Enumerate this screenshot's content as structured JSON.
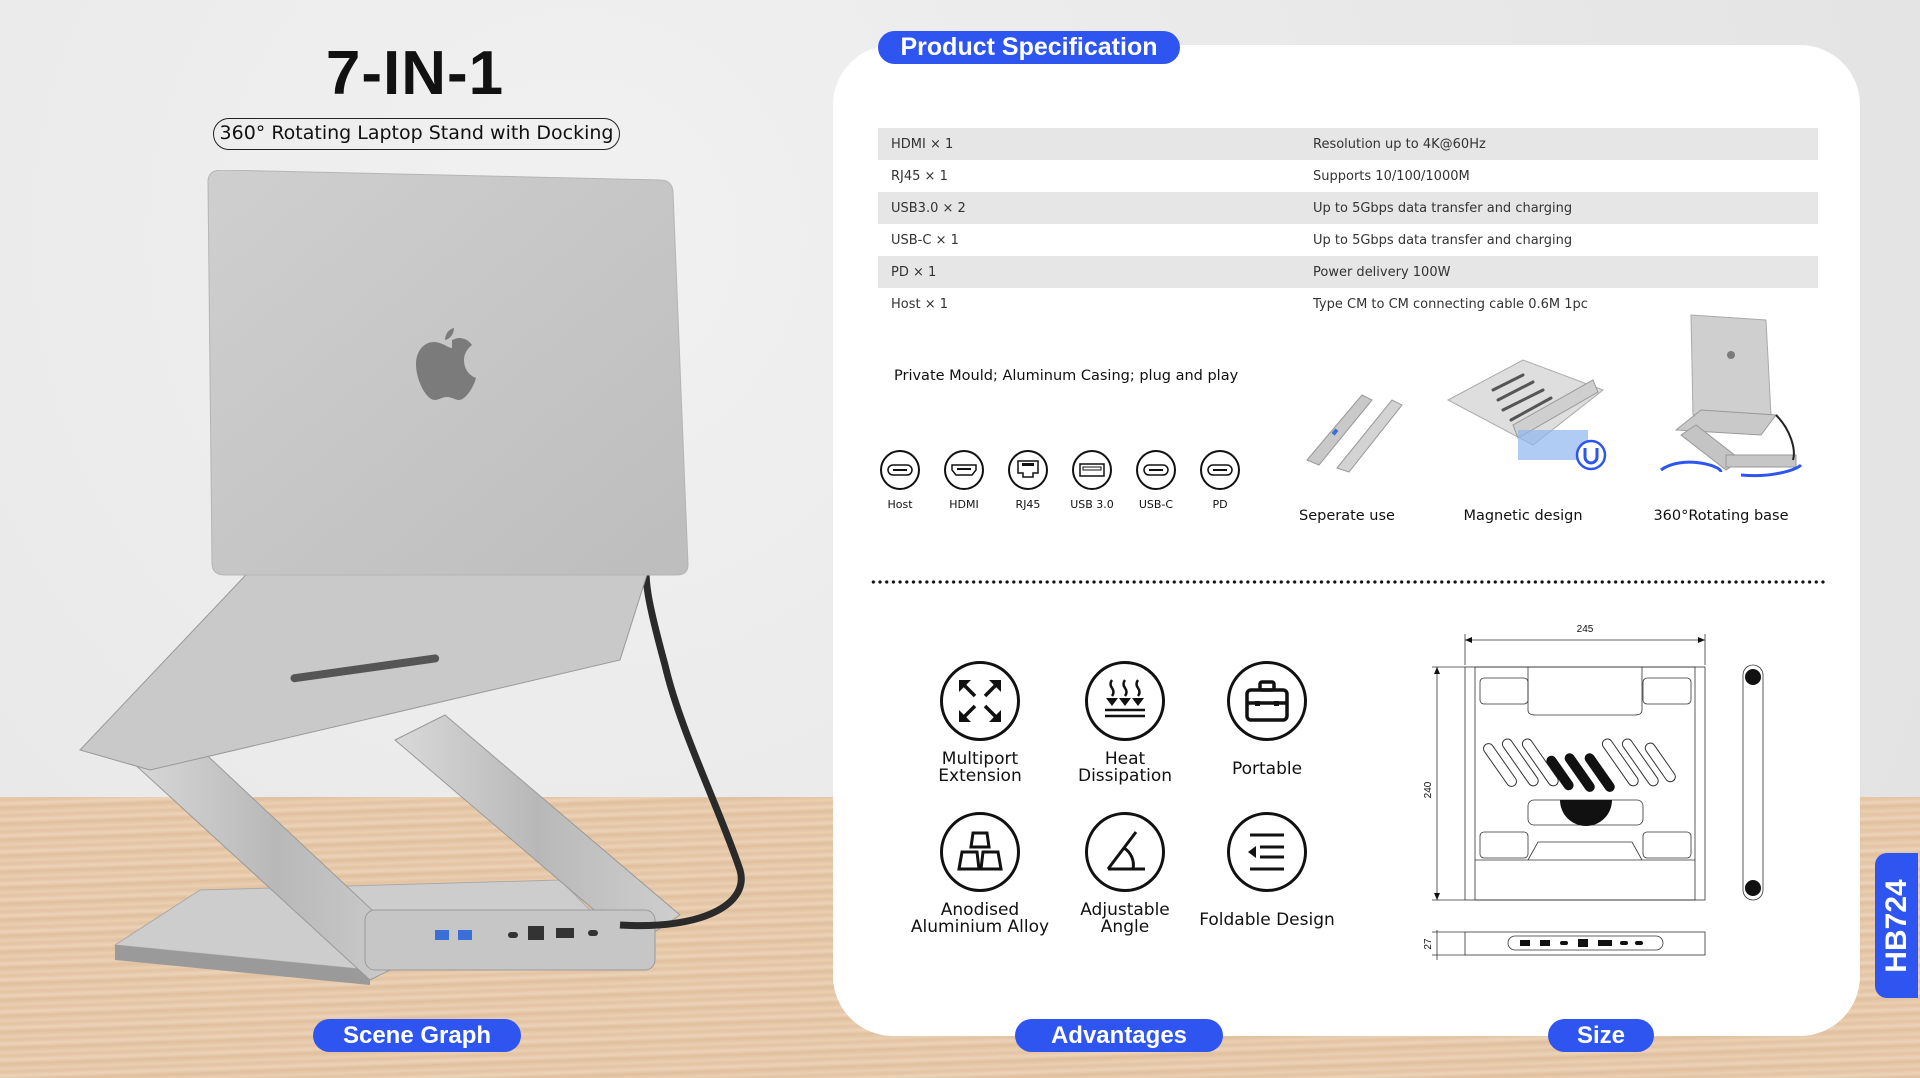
{
  "header": {
    "title": "7-IN-1",
    "subtitle": "360° Rotating Laptop Stand with Docking"
  },
  "spec": {
    "heading": "Product Specification",
    "rows": [
      {
        "port": "HDMI × 1",
        "desc": "Resolution up to 4K@60Hz"
      },
      {
        "port": "RJ45 × 1",
        "desc": "Supports 10/100/1000M"
      },
      {
        "port": "USB3.0 × 2",
        "desc": "Up to 5Gbps data transfer and charging"
      },
      {
        "port": "USB-C × 1",
        "desc": "Up to 5Gbps data transfer and charging"
      },
      {
        "port": "PD × 1",
        "desc": "Power delivery 100W"
      },
      {
        "port": "Host × 1",
        "desc": "Type CM to CM connecting cable 0.6M 1pc"
      }
    ],
    "tagline": "Private Mould; Aluminum Casing; plug and play",
    "port_icons": [
      {
        "label": "Host",
        "icon": "usb-c-port-icon"
      },
      {
        "label": "HDMI",
        "icon": "hdmi-port-icon"
      },
      {
        "label": "RJ45",
        "icon": "rj45-port-icon"
      },
      {
        "label": "USB 3.0",
        "icon": "usb-a-port-icon"
      },
      {
        "label": "USB-C",
        "icon": "usb-c-port-icon"
      },
      {
        "label": "PD",
        "icon": "usb-c-port-icon"
      }
    ],
    "features": [
      {
        "label": "Seperate use"
      },
      {
        "label": "Magnetic design"
      },
      {
        "label": "360°Rotating base"
      }
    ]
  },
  "advantages": {
    "items": [
      {
        "line1": "Multiport",
        "line2": "Extension",
        "icon": "expand-arrows-icon"
      },
      {
        "line1": "Heat",
        "line2": "Dissipation",
        "icon": "heat-icon"
      },
      {
        "line1": "Portable",
        "line2": "",
        "icon": "briefcase-icon"
      },
      {
        "line1": "Anodised",
        "line2": "Aluminium Alloy",
        "icon": "ingots-icon"
      },
      {
        "line1": "Adjustable",
        "line2": "Angle",
        "icon": "angle-icon"
      },
      {
        "line1": "Foldable Design",
        "line2": "",
        "icon": "fold-icon"
      }
    ]
  },
  "size": {
    "width": "245",
    "depth": "240",
    "height": "27"
  },
  "bottom_labels": {
    "scene": "Scene Graph",
    "advantages": "Advantages",
    "size": "Size"
  },
  "model": "HB724",
  "colors": {
    "accent": "#2f55f0"
  }
}
